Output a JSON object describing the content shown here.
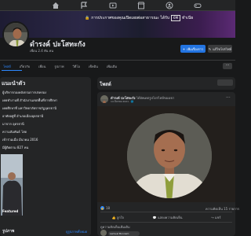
{
  "nav": {
    "icons": [
      "home-icon",
      "flag-icon",
      "video-icon",
      "marketplace-icon",
      "groups-icon",
      "gaming-icon"
    ]
  },
  "cover": {
    "announcement_text": "การประกาศของคุณเปิดเผยต่อสาธารณะ ได้รับ",
    "announcement_badge": "6M",
    "announcement_suffix": "ทำเนีย"
  },
  "profile": {
    "name": "ดำรงค์ ปะโสทะกัง",
    "friends": "เพื่อน 2.4 พัน คน",
    "add_story_button": "เพิ่มเรื่องราว",
    "edit_profile_button": "แก้ไขโปรไฟล์"
  },
  "tabs": [
    "โพสต์",
    "เกี่ยวกับ",
    "เพื่อน",
    "รูปภาพ",
    "วิดีโอ",
    "เช็คอิน",
    "เพิ่มเติม"
  ],
  "tab_more": "···",
  "intro": {
    "title": "แนะนำตัว",
    "lines": [
      "ผู้บริหารกองคลังกรมการปกครอง",
      "เคยทำงานที่ สำนักงานเขตพื้นที่การศึกษา",
      "เคยศึกษาที่ มหาวิทยาลัยราชภัฏอุดรธานี",
      "อาศัยอยู่ที่ อำเภอเมืองอุดรธานี",
      "มาจาก อุดรธานี",
      "ความสัมพันธ์ โสด",
      "เข้าร่วมเมื่อ มีนาคม 2016",
      "มีผู้ติดตาม 827 คน"
    ],
    "featured_label": "Featured",
    "bottom_left": "รูปภาพ",
    "bottom_right": "ดูรูปภาพทั้งหมด"
  },
  "posts": {
    "title": "โพสต์",
    "author": "ดำรงค์ ปะโสทะกัง",
    "author_action": "ได้อัพเดตรูปโปรไฟล์ของเขา",
    "date": "14 มีนาคม 2021 · 🌐",
    "like_count": "18",
    "stats_right": "ความคิดเห็น 15 รายการ",
    "actions": [
      "ถูกใจ",
      "แสดงความคิดเห็น",
      "แชร์"
    ],
    "comments_more": "ดูความคิดเห็นเพิ่มเติม",
    "commenter": "Lamuel Bonnam"
  },
  "colors": {
    "accent": "#2d88ff",
    "background": "#18191a",
    "card": "#242526"
  }
}
